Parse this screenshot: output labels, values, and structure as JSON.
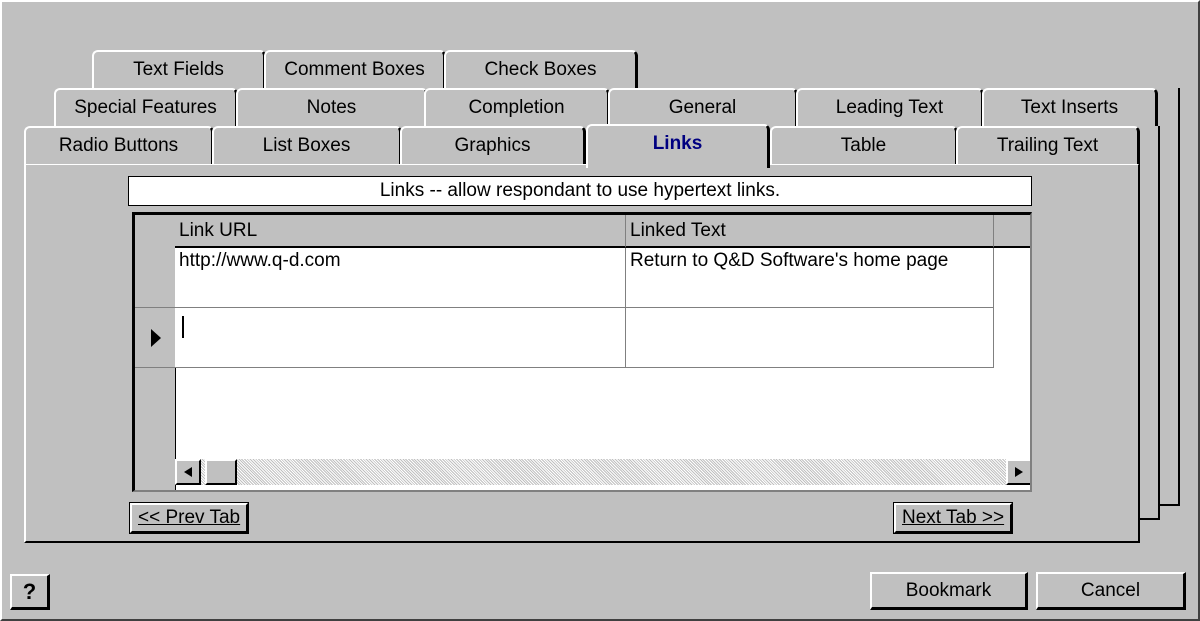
{
  "tabs": {
    "row1": [
      "Text Fields",
      "Comment Boxes",
      "Check Boxes"
    ],
    "row2": [
      "Special Features",
      "Notes",
      "Completion",
      "General",
      "Leading Text",
      "Text Inserts"
    ],
    "row3": [
      "Radio Buttons",
      "List Boxes",
      "Graphics",
      "Links",
      "Table",
      "Trailing Text"
    ],
    "active": "Links"
  },
  "description": "Links -- allow respondant to use hypertext links.",
  "grid": {
    "columns": [
      "Link URL",
      "Linked Text"
    ],
    "rows": [
      {
        "url": "http://www.q-d.com",
        "text": "Return to Q&D Software's home page"
      },
      {
        "url": "",
        "text": ""
      }
    ]
  },
  "nav": {
    "prev": "<< Prev Tab",
    "next": "Next Tab >>"
  },
  "buttons": {
    "help": "?",
    "bookmark": "Bookmark",
    "cancel": "Cancel"
  },
  "colors": {
    "active_tab": "#000080",
    "face": "#c0c0c0"
  }
}
